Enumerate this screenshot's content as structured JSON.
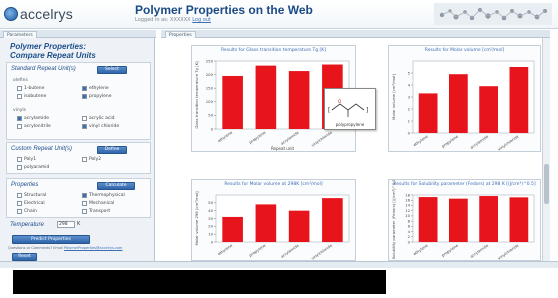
{
  "header": {
    "logo_text": "accelrys",
    "title": "Polymer Properties on the Web",
    "logged_in_text": "Logged in as: XXXXXX",
    "logout_label": "Log out"
  },
  "tabs": {
    "left_tab": "Parameters",
    "right_tab": "Properties"
  },
  "sidebar": {
    "panel_title_line1": "Polymer Properties:",
    "panel_title_line2": "Compare Repeat Units",
    "standard": {
      "title": "Standard Repeat Unit(s)",
      "select_button": "Select",
      "group1_label": "olefins",
      "group1_items": [
        {
          "label": "1-butene",
          "checked": false
        },
        {
          "label": "ethylene",
          "checked": true
        },
        {
          "label": "isobutene",
          "checked": false
        },
        {
          "label": "propylene",
          "checked": true
        }
      ],
      "group2_label": "vinyls",
      "group2_items": [
        {
          "label": "acrylamide",
          "checked": true
        },
        {
          "label": "acrylic acid",
          "checked": false
        },
        {
          "label": "acrylonitrile",
          "checked": false
        },
        {
          "label": "vinyl chloride",
          "checked": true
        }
      ]
    },
    "custom": {
      "title": "Custom Repeat Unit(s)",
      "define_button": "Define",
      "items": [
        {
          "label": "Poly1",
          "checked": false
        },
        {
          "label": "Poly2",
          "checked": false
        },
        {
          "label": "polyaramid",
          "checked": false
        }
      ]
    },
    "properties": {
      "title": "Properties",
      "calculate_button": "Calculate",
      "items": [
        {
          "label": "Structural",
          "checked": false
        },
        {
          "label": "Thermophysical",
          "checked": true
        },
        {
          "label": "Electrical",
          "checked": false
        },
        {
          "label": "Mechanical",
          "checked": false
        },
        {
          "label": "Chain",
          "checked": false
        },
        {
          "label": "Transport",
          "checked": false
        }
      ]
    },
    "temperature": {
      "label": "Temperature",
      "value": "298",
      "unit": "K"
    },
    "predict_button": "Predict Properties",
    "footnote_prefix": "Questions or Comments? Email",
    "footnote_link": "PolymerProperties@accelrys.com",
    "reset_button": "Reset"
  },
  "structure_popup": {
    "label": "polypropylene"
  },
  "colors": {
    "bar": "#e8141c",
    "accent": "#2f64aa",
    "title_blue": "#1d4f8c"
  },
  "chart_data": [
    {
      "type": "bar",
      "title": "Results for Glass transition temperature Tg [K]",
      "xlabel": "Repeat unit",
      "ylabel": "Glass transition temperature Tg [K]",
      "categories": [
        "ethylene",
        "propylene",
        "acrylamide",
        "vinylchloride"
      ],
      "values": [
        195,
        233,
        213,
        237
      ],
      "ylim": [
        0,
        250
      ],
      "yticks": [
        0,
        50,
        100,
        150,
        200,
        250
      ]
    },
    {
      "type": "bar",
      "title": "Results for Molar volume [cm³/mol]",
      "xlabel": "",
      "ylabel": "Molar volume [cm³/mol]",
      "categories": [
        "ethylene",
        "propylene",
        "acrylamide",
        "vinylchloride"
      ],
      "values": [
        3.3,
        4.9,
        3.9,
        5.5
      ],
      "ylim": [
        0,
        6
      ],
      "yticks": [
        0,
        1,
        2,
        3,
        4,
        5
      ]
    },
    {
      "type": "bar",
      "title": "Results for Molar volume at 298K [cm³/mol]",
      "xlabel": "",
      "ylabel": "Molar volume 298 [cm³/mol]",
      "categories": [
        "ethylene",
        "propylene",
        "acrylamide",
        "vinylchloride"
      ],
      "values": [
        32,
        48,
        40,
        56
      ],
      "ylim": [
        0,
        60
      ],
      "yticks": [
        0,
        10,
        20,
        30,
        40,
        50
      ]
    },
    {
      "type": "bar",
      "title": "Results for Solubility parameter (Fedors) at 298 K [(J/cm³)^0.5]",
      "xlabel": "",
      "ylabel": "Solubility parameter (Fedors) [(J/cm³)^0.5]",
      "categories": [
        "ethylene",
        "propylene",
        "acrylamide",
        "vinylchloride"
      ],
      "values": [
        17.2,
        16.6,
        17.6,
        17.1
      ],
      "ylim": [
        0,
        18
      ],
      "yticks": [
        0,
        2,
        4,
        6,
        8,
        10,
        12,
        14,
        16,
        18
      ]
    }
  ]
}
